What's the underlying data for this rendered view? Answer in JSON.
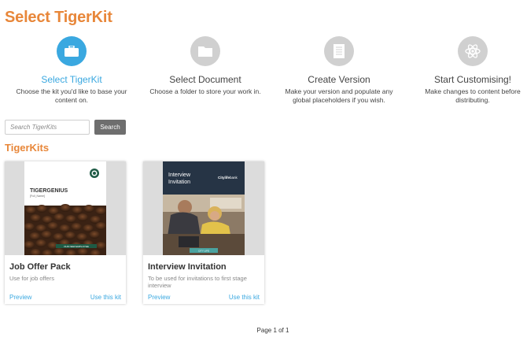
{
  "header": {
    "title": "Select TigerKit"
  },
  "steps": [
    {
      "title": "Select TigerKit",
      "desc": "Choose the kit you'd like to base your content on.",
      "icon": "briefcase-icon",
      "active": true
    },
    {
      "title": "Select Document",
      "desc": "Choose a folder to store your work in.",
      "icon": "folder-icon",
      "active": false
    },
    {
      "title": "Create Version",
      "desc": "Make your version and populate any global placeholders if you wish.",
      "icon": "document-icon",
      "active": false
    },
    {
      "title": "Start Customising!",
      "desc": "Make changes to content before distributing.",
      "icon": "atom-icon",
      "active": false
    }
  ],
  "search": {
    "placeholder": "Search TigerKits",
    "button_label": "Search"
  },
  "section": {
    "title": "TigerKits"
  },
  "cards": [
    {
      "name": "Job Offer Pack",
      "desc": "Use for job offers",
      "preview_label": "Preview",
      "use_label": "Use this kit",
      "thumb": {
        "brand": "TIGERGENIUS",
        "placeholder": "[Full_Name]",
        "footer": "OUR NEW EMPLOYEE"
      }
    },
    {
      "name": "Interview Invitation",
      "desc": "To be used for invitations to first stage interview",
      "preview_label": "Preview",
      "use_label": "Use this kit",
      "thumb": {
        "title_line1": "Interview",
        "title_line2": "Invitation",
        "logo_bold": "Citylife",
        "logo_rest": "bank",
        "footer": "CITY LIFE"
      }
    }
  ],
  "pagination": {
    "text": "Page 1 of 1"
  },
  "colors": {
    "accent_orange": "#e8873a",
    "accent_blue": "#3aa8e0",
    "inactive_gray": "#d0d0d0"
  }
}
